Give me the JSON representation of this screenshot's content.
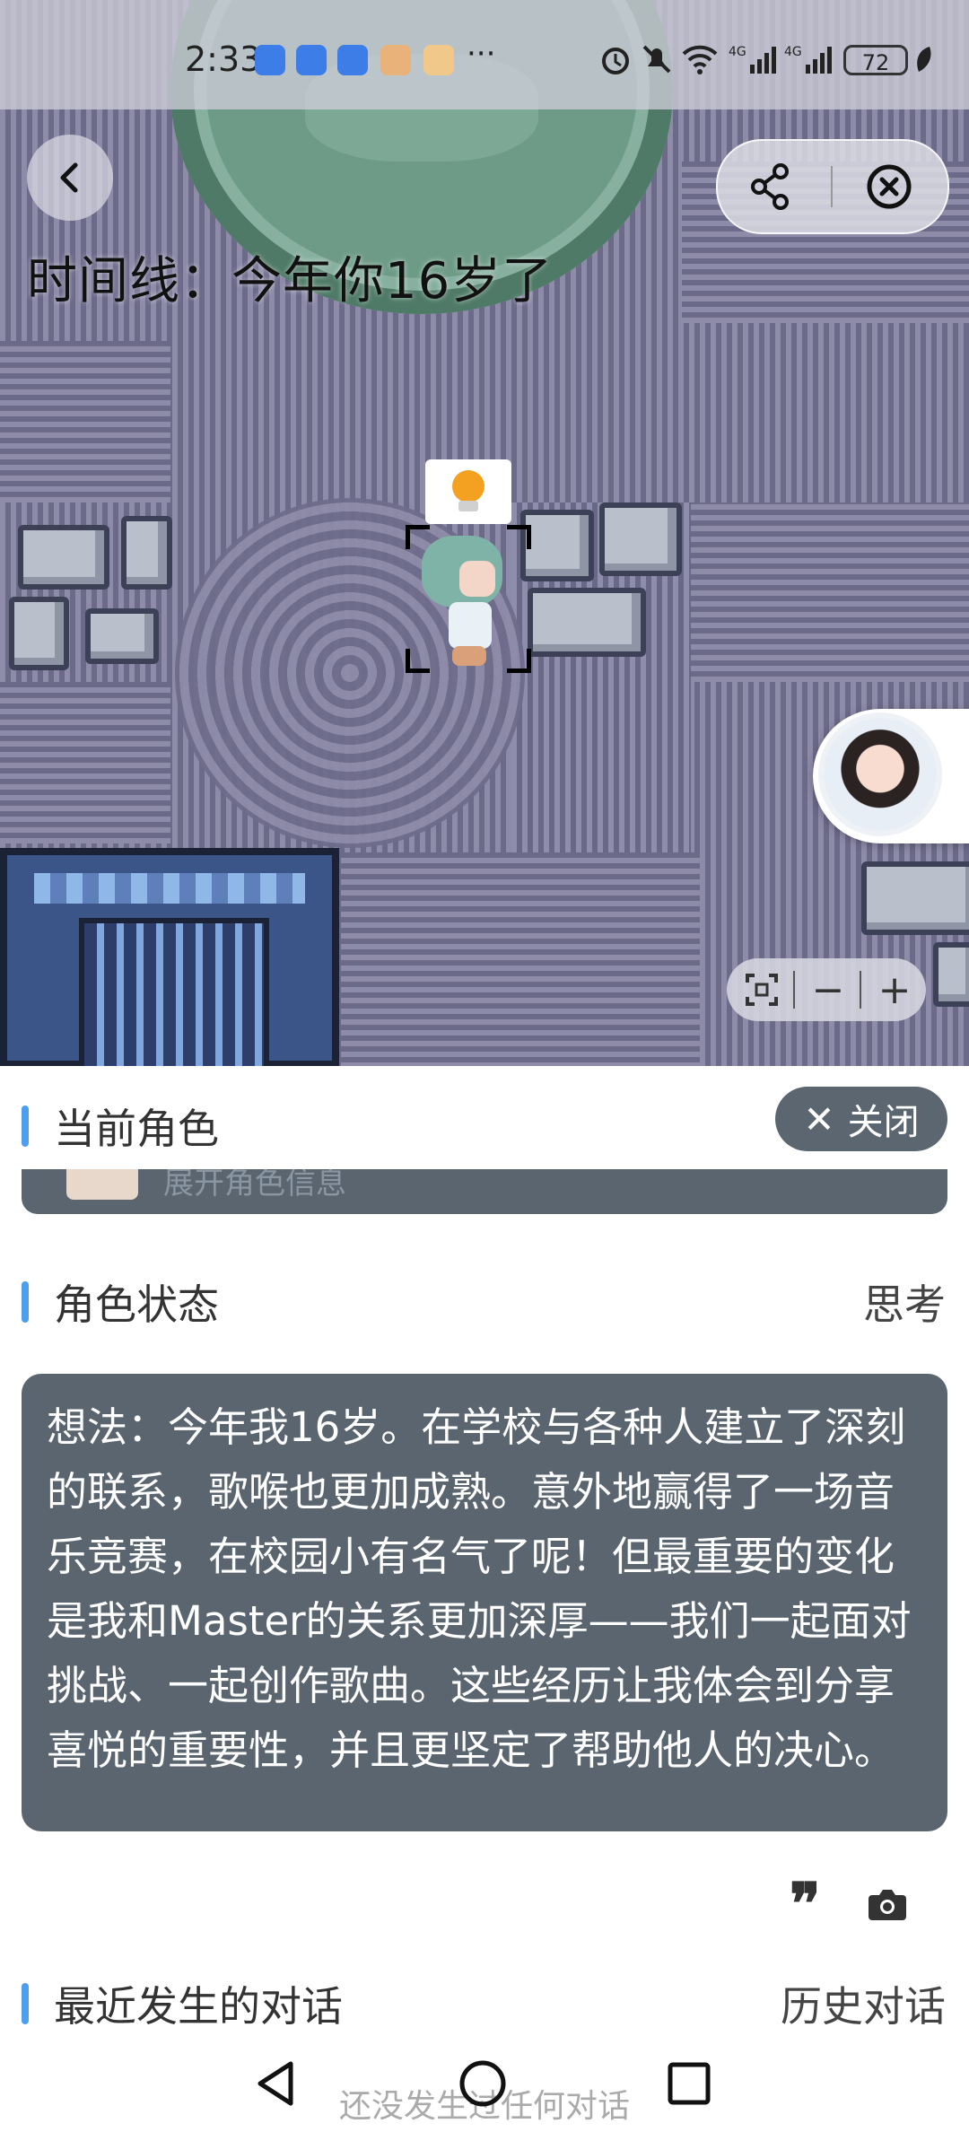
{
  "status_bar": {
    "time": "2:33",
    "more": "···",
    "battery": "72",
    "icons": [
      "alarm-icon",
      "mute-icon",
      "wifi-icon",
      "signal-4g-icon",
      "signal-4g-icon",
      "battery-icon",
      "leaf-icon"
    ]
  },
  "map": {
    "timeline": "时间线：今年你16岁了",
    "back_icon": "chevron-left-icon",
    "share_icon": "share-icon",
    "close_icon": "close-circle-icon",
    "zoom_fit_icon": "fit-screen-icon",
    "zoom_out": "−",
    "zoom_in": "+"
  },
  "panel": {
    "current_role": {
      "title": "当前角色",
      "close_label": "关闭",
      "expand_text": "展开角色信息"
    },
    "role_status": {
      "title": "角色状态",
      "mode": "思考",
      "thought": "想法：今年我16岁。在学校与各种人建立了深刻的联系，歌喉也更加成熟。意外地赢得了一场音乐竞赛，在校园小有名气了呢！但最重要的变化是我和Master的关系更加深厚——我们一起面对挑战、一起创作歌曲。这些经历让我体会到分享喜悦的重要性，并且更坚定了帮助他人的决心。"
    },
    "recent_chats": {
      "title": "最近发生的对话",
      "history": "历史对话",
      "empty": "还没发生过任何对话"
    }
  },
  "colors": {
    "accent_bar": "#4e9ef0",
    "card_bg": "#5a6570",
    "pill_bg": "#5b6670"
  }
}
